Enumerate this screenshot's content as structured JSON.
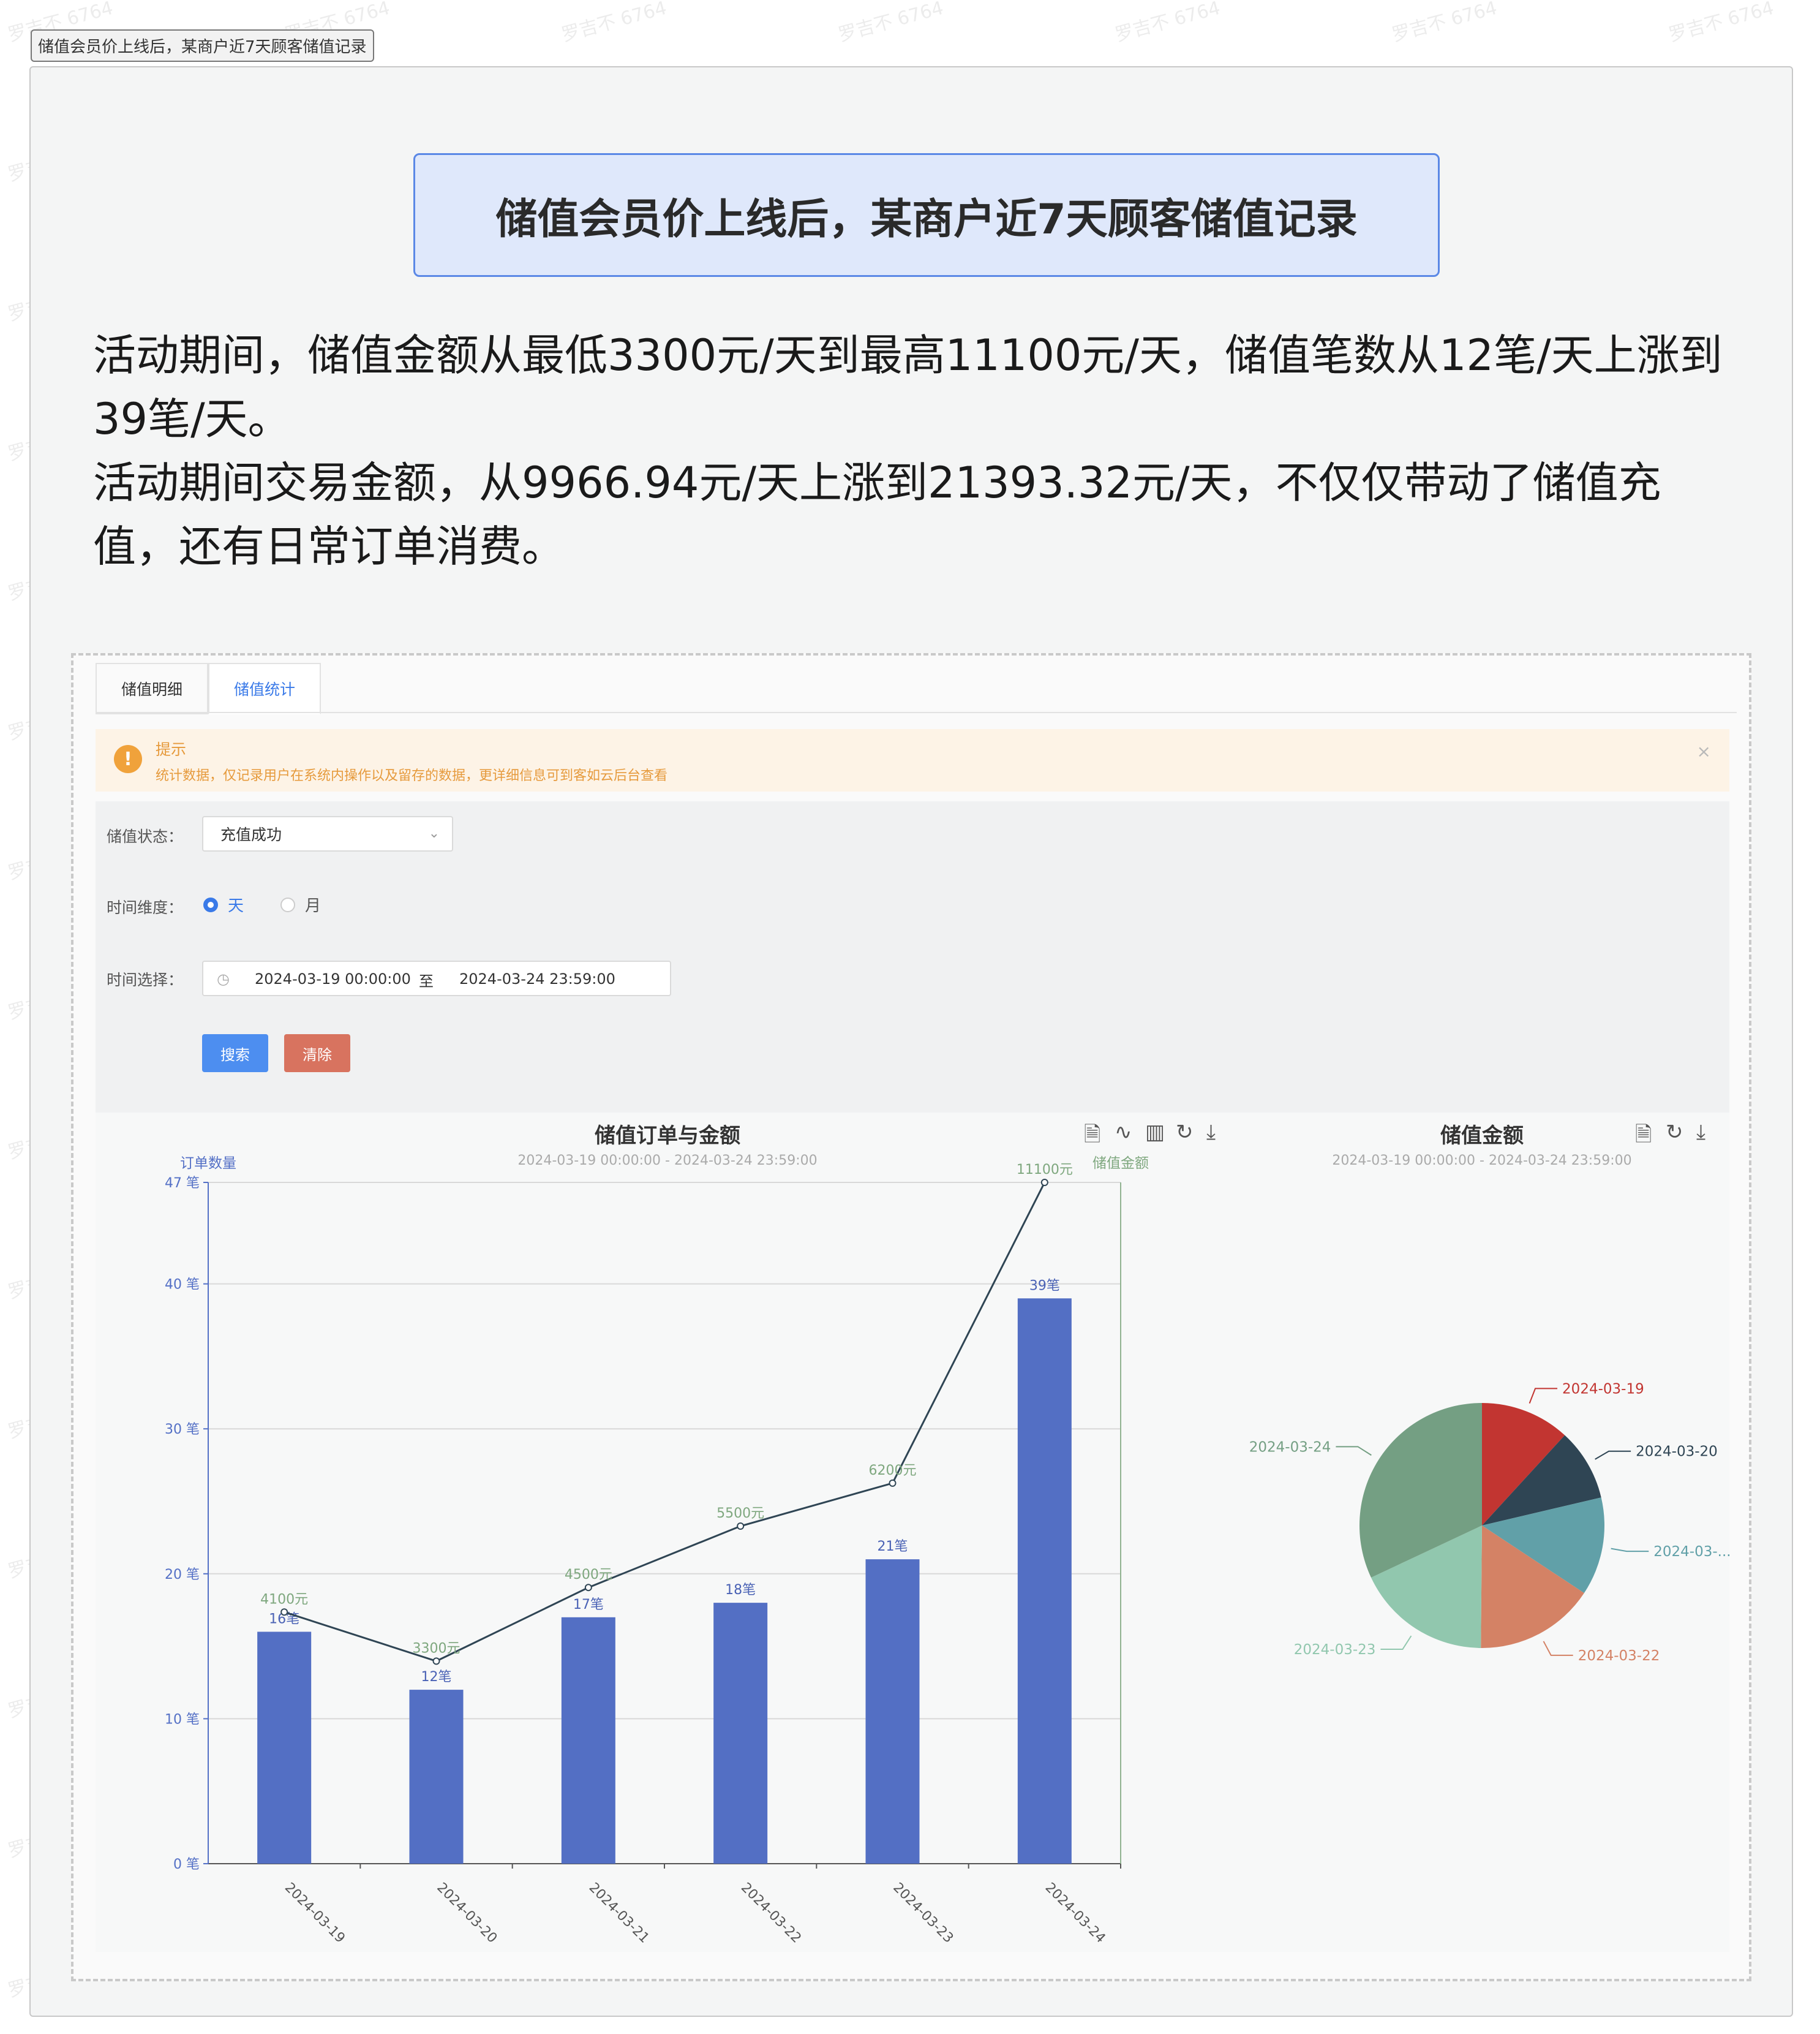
{
  "doc_tag": "储值会员价上线后，某商户近7天顾客储值记录",
  "headline": "储值会员价上线后，某商户近7天顾客储值记录",
  "summary": [
    "活动期间，储值金额从最低3300元/天到最高11100元/天，储值笔数从12笔/天上涨到39笔/天。",
    "活动期间交易金额，从9966.94元/天上涨到21393.32元/天，不仅仅带动了储值充值，还有日常订单消费。"
  ],
  "watermark": "罗吉不 6764",
  "tabs": [
    {
      "label": "储值明细",
      "active": false
    },
    {
      "label": "储值统计",
      "active": true
    }
  ],
  "alert": {
    "title": "提示",
    "text": "统计数据，仅记录用户在系统内操作以及留存的数据，更详细信息可到客如云后台查看",
    "icon": "warning-icon",
    "close": "×"
  },
  "form": {
    "status_label": "储值状态：",
    "status_value": "充值成功",
    "dimension_label": "时间维度：",
    "dimension_options": [
      "天",
      "月"
    ],
    "dimension_selected": "天",
    "time_label": "时间选择：",
    "time_start": "2024-03-19 00:00:00",
    "time_sep": "至",
    "time_end": "2024-03-24 23:59:00",
    "search_label": "搜索",
    "clear_label": "清除",
    "colors": {
      "primary": "#4d8ef0",
      "danger": "#d8735f"
    }
  },
  "chart_data": [
    {
      "type": "bar",
      "title": "储值订单与金额",
      "subtitle": "2024-03-19 00:00:00 - 2024-03-24 23:59:00",
      "ylabel": "订单数量",
      "y2label": "储值金额",
      "categories": [
        "2024-03-19",
        "2024-03-20",
        "2024-03-21",
        "2024-03-22",
        "2024-03-23",
        "2024-03-24"
      ],
      "yticks": [
        "0 笔",
        "10 笔",
        "20 笔",
        "30 笔",
        "40 笔",
        "47 笔"
      ],
      "ytick_values": [
        0,
        10,
        20,
        30,
        40,
        47
      ],
      "ylim": [
        0,
        47
      ],
      "y2lim": [
        0,
        11100
      ],
      "series": [
        {
          "kind": "bar",
          "values": [
            16,
            12,
            17,
            18,
            21,
            39
          ],
          "labels": [
            "16笔",
            "12笔",
            "17笔",
            "18笔",
            "21笔",
            "39笔"
          ],
          "color": "#536fc4"
        },
        {
          "kind": "line",
          "values": [
            4100,
            3300,
            4500,
            5500,
            6200,
            11100
          ],
          "labels": [
            "4100元",
            "3300元",
            "4500元",
            "5500元",
            "6200元",
            "11100元"
          ],
          "color": "#2f4554"
        }
      ],
      "toolbar": [
        "data-view-icon",
        "line-icon",
        "bar-icon",
        "refresh-icon",
        "download-icon"
      ]
    },
    {
      "type": "pie",
      "title": "储值金额",
      "subtitle": "2024-03-19 00:00:00 - 2024-03-24 23:59:00",
      "categories": [
        "2024-03-19",
        "2024-03-20",
        "2024-03-21",
        "2024-03-22",
        "2024-03-23",
        "2024-03-24"
      ],
      "labels": [
        "2024-03-19",
        "2024-03-20",
        "2024-03-...",
        "2024-03-22",
        "2024-03-23",
        "2024-03-24"
      ],
      "values": [
        4100,
        3300,
        4500,
        5500,
        6200,
        11100
      ],
      "colors": [
        "#c23531",
        "#2f4554",
        "#61a0a8",
        "#d48265",
        "#91c7ae",
        "#749f83"
      ],
      "toolbar": [
        "data-view-icon",
        "refresh-icon",
        "download-icon"
      ]
    }
  ]
}
